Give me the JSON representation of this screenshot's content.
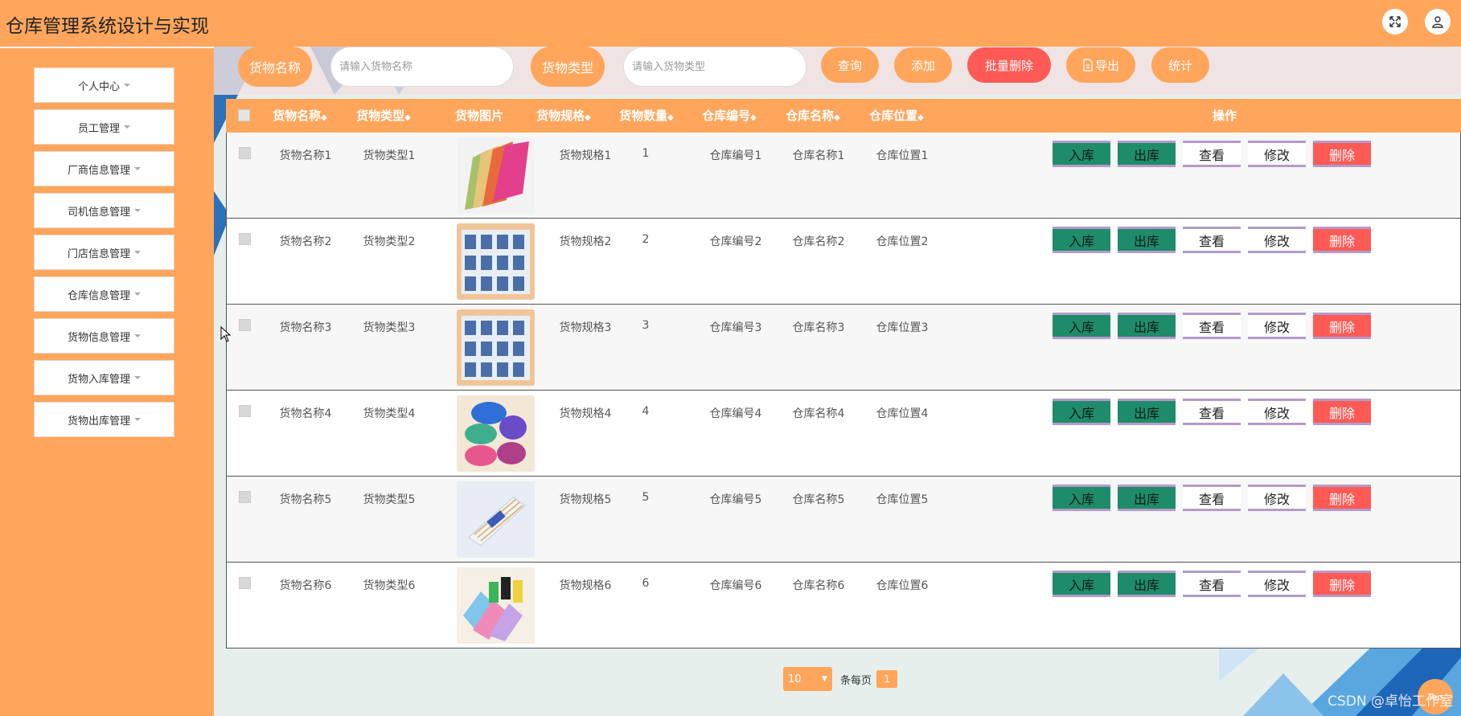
{
  "app": {
    "title": "仓库管理系统设计与实现"
  },
  "header": {
    "fullscreen_icon": "fullscreen-icon",
    "user_icon": "user-icon"
  },
  "colors": {
    "accent": "#ffa65c",
    "danger": "#ff5a55",
    "success": "#1e8c6a"
  },
  "sidebar": {
    "items": [
      {
        "label": "个人中心"
      },
      {
        "label": "员工管理"
      },
      {
        "label": "厂商信息管理"
      },
      {
        "label": "司机信息管理"
      },
      {
        "label": "门店信息管理"
      },
      {
        "label": "仓库信息管理"
      },
      {
        "label": "货物信息管理"
      },
      {
        "label": "货物入库管理"
      },
      {
        "label": "货物出库管理"
      }
    ]
  },
  "search": {
    "name_label": "货物名称",
    "name_placeholder": "请输入货物名称",
    "type_label": "货物类型",
    "type_placeholder": "请输入货物类型",
    "query_button": "查询",
    "add_button": "添加",
    "batch_delete_button": "批量删除",
    "export_button": "导出",
    "stats_button": "统计"
  },
  "table": {
    "columns": [
      "货物名称",
      "货物类型",
      "货物图片",
      "货物规格",
      "货物数量",
      "仓库编号",
      "仓库名称",
      "仓库位置",
      "操作"
    ],
    "actions": {
      "in": "入库",
      "out": "出库",
      "view": "查看",
      "edit": "修改",
      "delete": "删除"
    },
    "rows": [
      {
        "name": "货物名称1",
        "type": "货物类型1",
        "image": "pink-towels",
        "spec": "货物规格1",
        "qty": "1",
        "wh_no": "仓库编号1",
        "wh_name": "仓库名称1",
        "wh_loc": "仓库位置1"
      },
      {
        "name": "货物名称2",
        "type": "货物类型2",
        "image": "tissue-pack",
        "spec": "货物规格2",
        "qty": "2",
        "wh_no": "仓库编号2",
        "wh_name": "仓库名称2",
        "wh_loc": "仓库位置2"
      },
      {
        "name": "货物名称3",
        "type": "货物类型3",
        "image": "tissue-pack",
        "spec": "货物规格3",
        "qty": "3",
        "wh_no": "仓库编号3",
        "wh_name": "仓库名称3",
        "wh_loc": "仓库位置3"
      },
      {
        "name": "货物名称4",
        "type": "货物类型4",
        "image": "rolled-towels",
        "spec": "货物规格4",
        "qty": "4",
        "wh_no": "仓库编号4",
        "wh_name": "仓库名称4",
        "wh_loc": "仓库位置4"
      },
      {
        "name": "货物名称5",
        "type": "货物类型5",
        "image": "cotton-swabs",
        "spec": "货物规格5",
        "qty": "5",
        "wh_no": "仓库编号5",
        "wh_name": "仓库名称5",
        "wh_loc": "仓库位置5"
      },
      {
        "name": "货物名称6",
        "type": "货物类型6",
        "image": "trash-bags",
        "spec": "货物规格6",
        "qty": "6",
        "wh_no": "仓库编号6",
        "wh_name": "仓库名称6",
        "wh_loc": "仓库位置6"
      }
    ]
  },
  "pagination": {
    "page_size": "10",
    "per_page_text": "条每页",
    "current_page": "1"
  },
  "footer": {
    "watermark": "CSDN @卓怡工作室",
    "top_button": "Top"
  }
}
